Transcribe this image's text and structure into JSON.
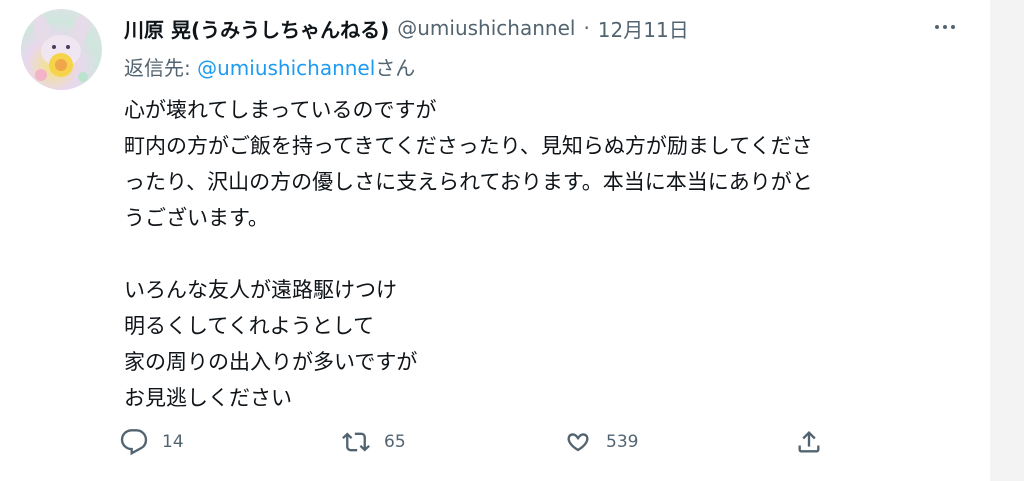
{
  "tweet": {
    "display_name": "川原 晃(うみうしちゃんねる)",
    "handle": "@umiushichannel",
    "separator": "·",
    "date": "12月11日",
    "reply_prefix": "返信先: ",
    "reply_to": "@umiushichannel",
    "reply_suffix": "さん",
    "lines_para1": [
      "心が壊れてしまっているのですが",
      "町内の方がご飯を持ってきてくださったり、見知らぬ方が励ましてくださ",
      "ったり、沢山の方の優しさに支えられております。本当に本当にありがと",
      "うございます。"
    ],
    "lines_para2": [
      "いろんな友人が遠路駆けつけ",
      "明るくしてくれようとして",
      "家の周りの出入りが多いですが",
      "お見逃しください"
    ]
  },
  "actions": {
    "reply_count": "14",
    "retweet_count": "65",
    "like_count": "539"
  },
  "icons": {
    "more": "more-icon",
    "reply": "reply-icon",
    "retweet": "retweet-icon",
    "like": "heart-icon",
    "share": "share-icon"
  },
  "colors": {
    "text": "#0f1419",
    "secondary": "#536471",
    "accent": "#1d9bf0"
  }
}
